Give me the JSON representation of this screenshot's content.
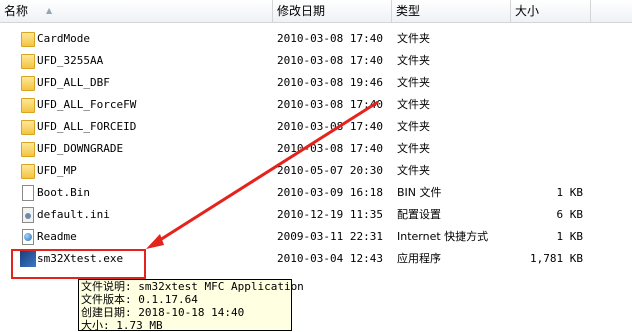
{
  "header": {
    "name": "名称",
    "date": "修改日期",
    "type": "类型",
    "size": "大小"
  },
  "rows": [
    {
      "name": "CardMode",
      "date": "2010-03-08 17:40",
      "type": "文件夹",
      "size": "",
      "icon": "folder-icon"
    },
    {
      "name": "UFD_3255AA",
      "date": "2010-03-08 17:40",
      "type": "文件夹",
      "size": "",
      "icon": "folder-icon"
    },
    {
      "name": "UFD_ALL_DBF",
      "date": "2010-03-08 19:46",
      "type": "文件夹",
      "size": "",
      "icon": "folder-icon"
    },
    {
      "name": "UFD_ALL_ForceFW",
      "date": "2010-03-08 17:40",
      "type": "文件夹",
      "size": "",
      "icon": "folder-icon"
    },
    {
      "name": "UFD_ALL_FORCEID",
      "date": "2010-03-08 17:40",
      "type": "文件夹",
      "size": "",
      "icon": "folder-icon"
    },
    {
      "name": "UFD_DOWNGRADE",
      "date": "2010-03-08 17:40",
      "type": "文件夹",
      "size": "",
      "icon": "folder-icon"
    },
    {
      "name": "UFD_MP",
      "date": "2010-05-07 20:30",
      "type": "文件夹",
      "size": "",
      "icon": "folder-icon"
    },
    {
      "name": "Boot.Bin",
      "date": "2010-03-09 16:18",
      "type": "BIN 文件",
      "size": "1 KB",
      "icon": "file-icon"
    },
    {
      "name": "default.ini",
      "date": "2010-12-19 11:35",
      "type": "配置设置",
      "size": "6 KB",
      "icon": "settings-file-icon"
    },
    {
      "name": "Readme",
      "date": "2009-03-11 22:31",
      "type": "Internet 快捷方式",
      "size": "1 KB",
      "icon": "internet-shortcut-icon"
    },
    {
      "name": "sm32Xtest.exe",
      "date": "2010-03-04 12:43",
      "type": "应用程序",
      "size": "1,781 KB",
      "icon": "application-icon"
    }
  ],
  "tooltip": {
    "line1": "文件说明: sm32xtest MFC Application",
    "line2": "文件版本: 0.1.17.64",
    "line3": "创建日期: 2018-10-18 14:40",
    "line4": "大小: 1.73 MB"
  },
  "annotation_color": "#e3231c"
}
